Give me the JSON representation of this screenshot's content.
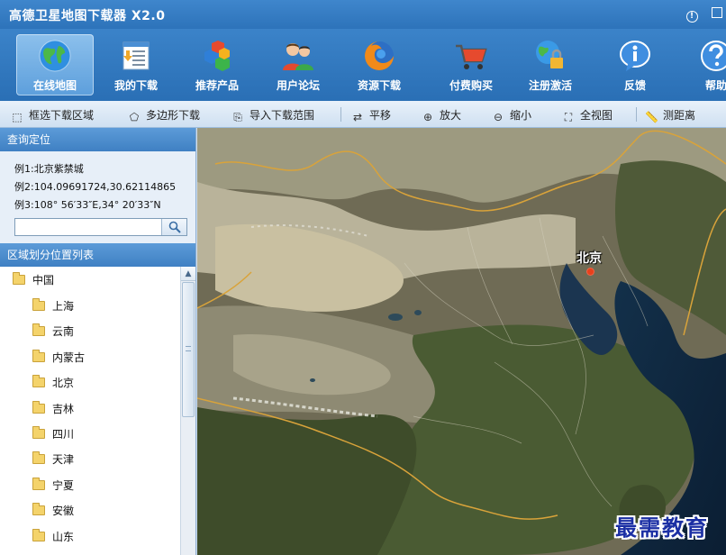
{
  "window": {
    "title": "高德卫星地图下载器 X2.0"
  },
  "nav": [
    {
      "label": "在线地图",
      "icon": "globe-icon",
      "active": true
    },
    {
      "label": "我的下载",
      "icon": "download-list-icon"
    },
    {
      "label": "推荐产品",
      "icon": "cubes-icon"
    },
    {
      "label": "用户论坛",
      "icon": "users-icon"
    },
    {
      "label": "资源下载",
      "icon": "firefox-globe-icon"
    },
    {
      "label": "付费购买",
      "icon": "shopping-cart-icon"
    },
    {
      "label": "注册激活",
      "icon": "globe-lock-icon"
    },
    {
      "label": "反馈",
      "icon": "info-bubble-icon"
    },
    {
      "label": "帮助",
      "icon": "help-icon"
    }
  ],
  "tools": {
    "rect_select": "框选下载区域",
    "polygon": "多边形下载",
    "import_range": "导入下载范围",
    "pan": "平移",
    "zoom_in": "放大",
    "zoom_out": "缩小",
    "full_view": "全视图",
    "measure": "测距离"
  },
  "query": {
    "header": "查询定位",
    "example1": "例1:北京紫禁城",
    "example2": "例2:104.09691724,30.62114865",
    "example3": "例3:108° 56′33″E,34° 20′33″N",
    "search_value": ""
  },
  "region": {
    "header": "区域划分位置列表",
    "root": "中国",
    "items": [
      "上海",
      "云南",
      "内蒙古",
      "北京",
      "吉林",
      "四川",
      "天津",
      "宁夏",
      "安徽",
      "山东"
    ]
  },
  "map": {
    "city_label": "北京",
    "watermark": "最需教育"
  },
  "colors": {
    "titlebar": "#2d73ba",
    "active_nav": "#6aa8e0",
    "marker": "#e8401c",
    "watermark": "#1b2fa4"
  }
}
